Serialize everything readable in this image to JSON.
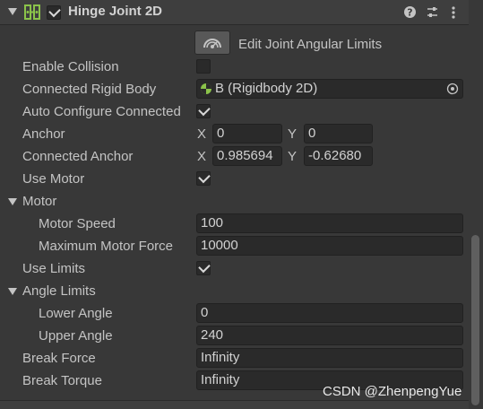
{
  "header": {
    "title": "Hinge Joint 2D",
    "enabled": true,
    "icons": [
      "help-icon",
      "preset-icon",
      "more-icon"
    ]
  },
  "edit_button": {
    "label": "Edit Joint Angular Limits"
  },
  "fields": {
    "enable_collision": {
      "label": "Enable Collision",
      "checked": false
    },
    "connected_rigid_body": {
      "label": "Connected Rigid Body",
      "value": "B (Rigidbody 2D)"
    },
    "auto_configure": {
      "label": "Auto Configure Connected",
      "checked": true
    },
    "anchor": {
      "label": "Anchor",
      "x_label": "X",
      "y_label": "Y",
      "x": "0",
      "y": "0"
    },
    "connected_anchor": {
      "label": "Connected Anchor",
      "x_label": "X",
      "y_label": "Y",
      "x": "0.985694",
      "y": "-0.62680"
    },
    "use_motor": {
      "label": "Use Motor",
      "checked": true
    },
    "motor": {
      "label": "Motor",
      "motor_speed": {
        "label": "Motor Speed",
        "value": "100"
      },
      "max_force": {
        "label": "Maximum Motor Force",
        "value": "10000"
      }
    },
    "use_limits": {
      "label": "Use Limits",
      "checked": true
    },
    "angle_limits": {
      "label": "Angle Limits",
      "lower": {
        "label": "Lower Angle",
        "value": "0"
      },
      "upper": {
        "label": "Upper Angle",
        "value": "240"
      }
    },
    "break_force": {
      "label": "Break Force",
      "value": "Infinity"
    },
    "break_torque": {
      "label": "Break Torque",
      "value": "Infinity"
    }
  },
  "watermark": "CSDN @ZhenpengYue",
  "colors": {
    "background": "#383838",
    "field": "#2a2a2a",
    "text": "#c4c4c4"
  }
}
